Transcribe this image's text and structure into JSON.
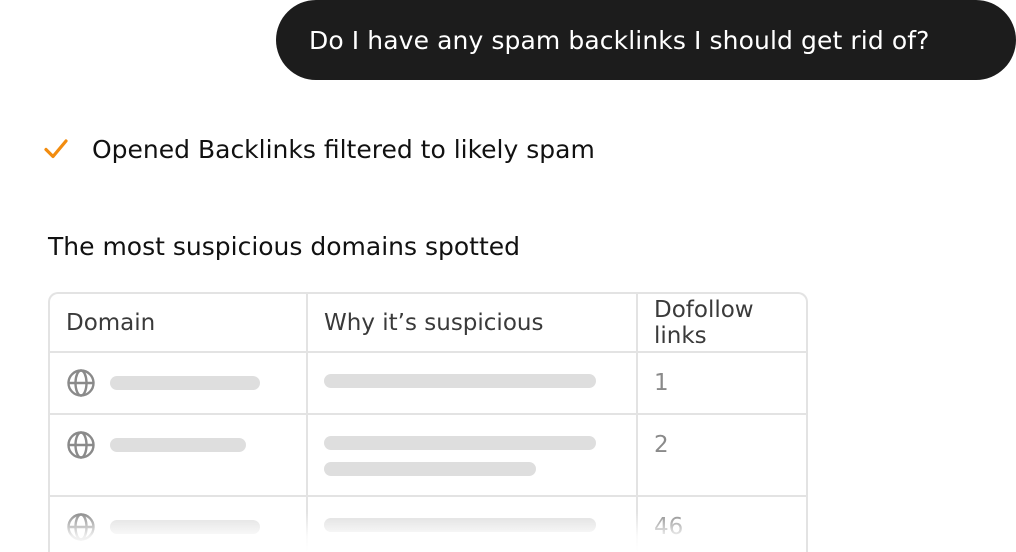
{
  "conversation": {
    "user_message": "Do I have any spam backlinks I should get rid of?"
  },
  "status": {
    "icon": "check-icon",
    "icon_color": "#f28c0f",
    "text": "Opened Backlinks filtered to likely spam"
  },
  "section": {
    "title": "The most suspicious domains spotted"
  },
  "table": {
    "headers": {
      "domain": "Domain",
      "why": "Why it’s suspicious",
      "dofollow": "Dofollow links"
    },
    "rows": [
      {
        "dofollow": "1"
      },
      {
        "dofollow": "2"
      },
      {
        "dofollow": "46"
      }
    ]
  },
  "colors": {
    "bubble_bg": "#1c1c1c",
    "skeleton": "#dedede",
    "border": "#e3e3e3"
  }
}
